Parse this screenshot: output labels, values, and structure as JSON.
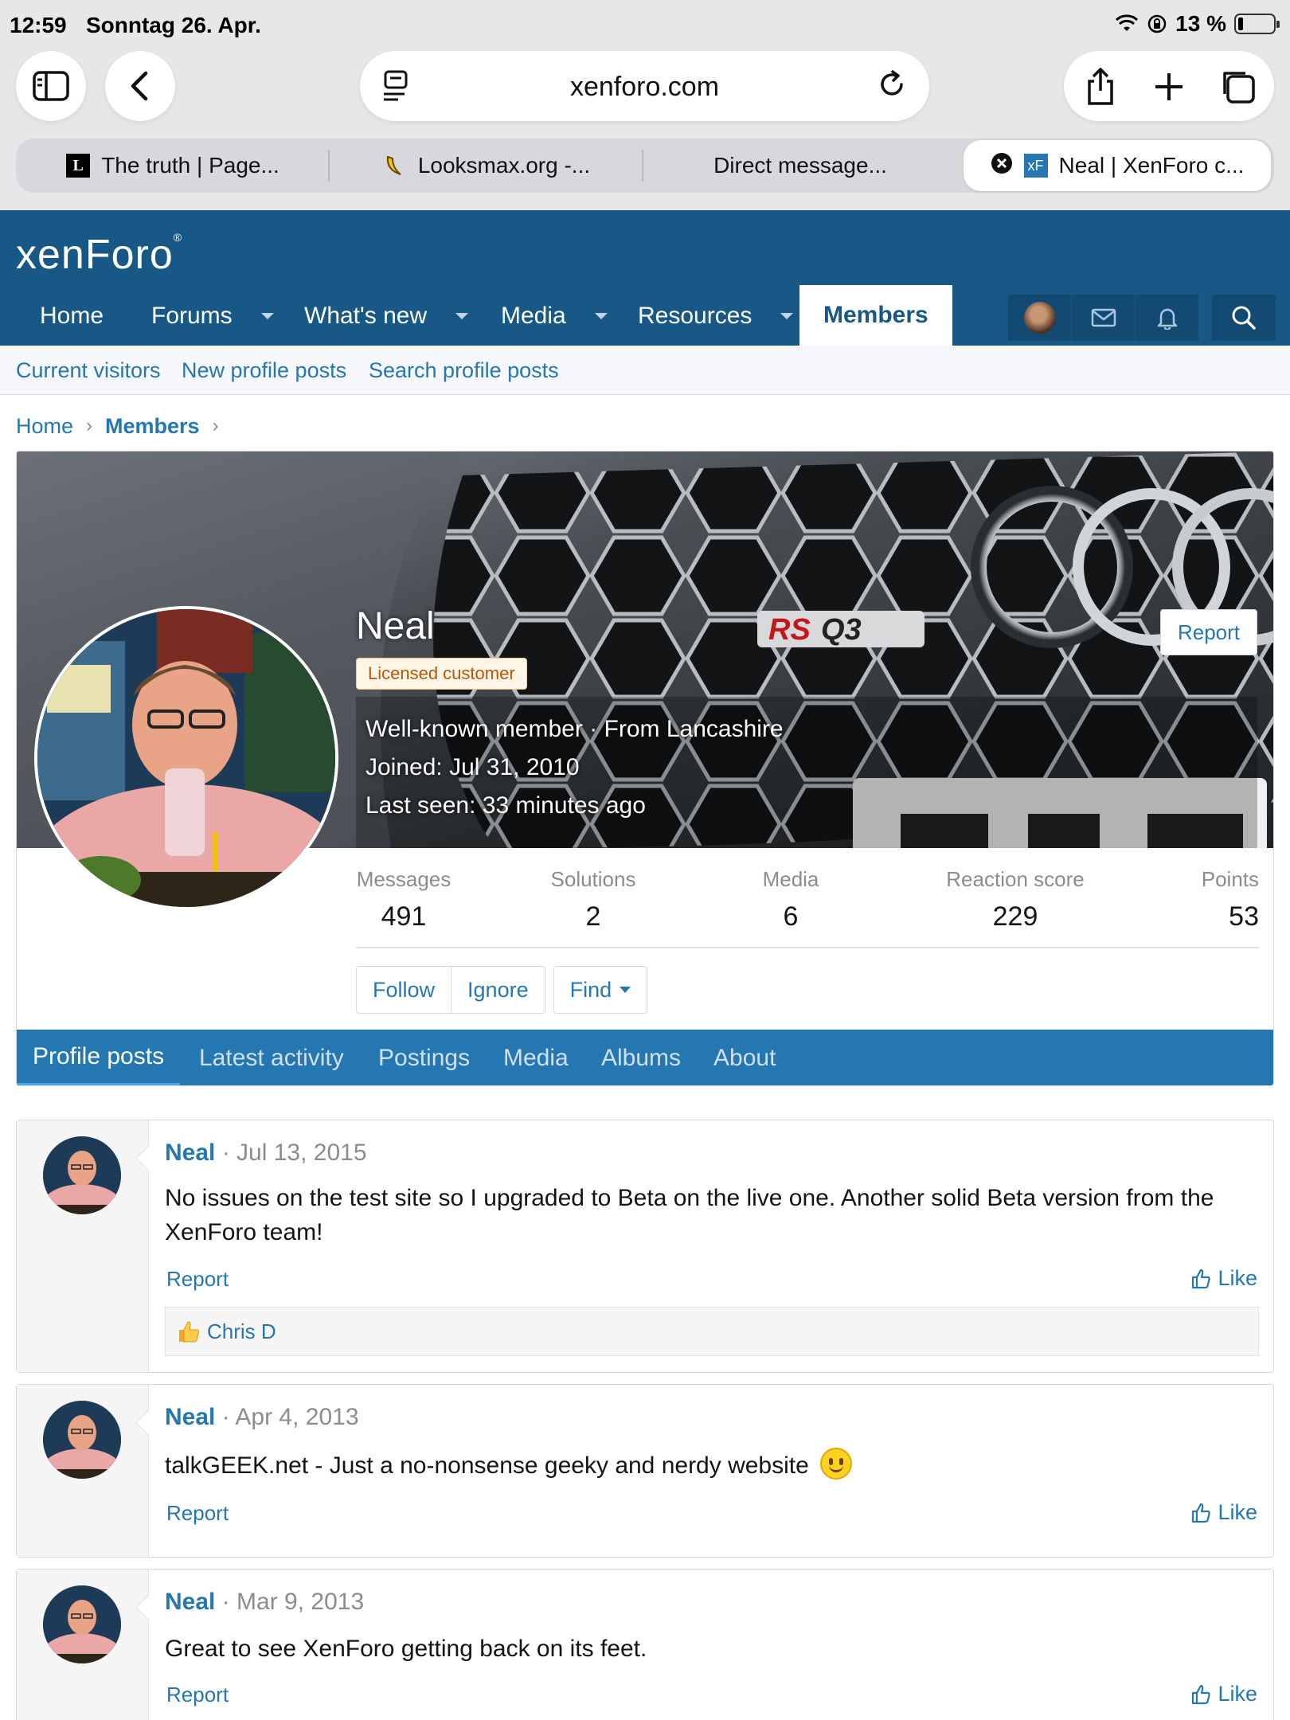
{
  "status_bar": {
    "time": "12:59",
    "date": "Sonntag 26. Apr.",
    "battery": "13 %"
  },
  "browser": {
    "domain": "xenforo.com",
    "tabs": [
      {
        "label": "The truth | Page...",
        "favicon_text": "L"
      },
      {
        "label": "Looksmax.org -..."
      },
      {
        "label": "Direct message..."
      },
      {
        "label": "Neal | XenForo c...",
        "favicon_text": "xF"
      }
    ]
  },
  "site": {
    "logo_text": "xenForo",
    "nav": [
      {
        "label": "Home"
      },
      {
        "label": "Forums"
      },
      {
        "label": "What's new"
      },
      {
        "label": "Media"
      },
      {
        "label": "Resources"
      },
      {
        "label": "Members"
      }
    ],
    "subnav": [
      "Current visitors",
      "New profile posts",
      "Search profile posts"
    ],
    "breadcrumb": [
      "Home",
      "Members"
    ]
  },
  "profile": {
    "name": "Neal",
    "banner_label": "Licensed customer",
    "report_label": "Report",
    "blurb_title": "Well-known member · From Lancashire",
    "joined_label": "Joined:",
    "joined_value": "Jul 31, 2010",
    "last_seen_label": "Last seen:",
    "last_seen_value": "33 minutes ago",
    "stats": [
      {
        "label": "Messages",
        "value": "491"
      },
      {
        "label": "Solutions",
        "value": "2"
      },
      {
        "label": "Media",
        "value": "6"
      },
      {
        "label": "Reaction score",
        "value": "229"
      },
      {
        "label": "Points",
        "value": "53"
      }
    ],
    "buttons": {
      "follow": "Follow",
      "ignore": "Ignore",
      "find": "Find"
    },
    "tabs": [
      "Profile posts",
      "Latest activity",
      "Postings",
      "Media",
      "Albums",
      "About"
    ]
  },
  "posts": [
    {
      "author": "Neal",
      "date": "· Jul 13, 2015",
      "body": "No issues on the test site so I upgraded to Beta on the live one. Another solid Beta version from the XenForo team!",
      "report": "Report",
      "like": "Like",
      "reaction_user": "Chris D"
    },
    {
      "author": "Neal",
      "date": "· Apr 4, 2013",
      "body": "talkGEEK.net - Just a no-nonsense geeky and nerdy website",
      "report": "Report",
      "like": "Like"
    },
    {
      "author": "Neal",
      "date": "· Mar 9, 2013",
      "body": "Great to see XenForo getting back on its feet.",
      "report": "Report",
      "like": "Like"
    }
  ],
  "colors": {
    "brand": "#185886",
    "link": "#2577b1",
    "tab_bar": "#2577b1"
  }
}
